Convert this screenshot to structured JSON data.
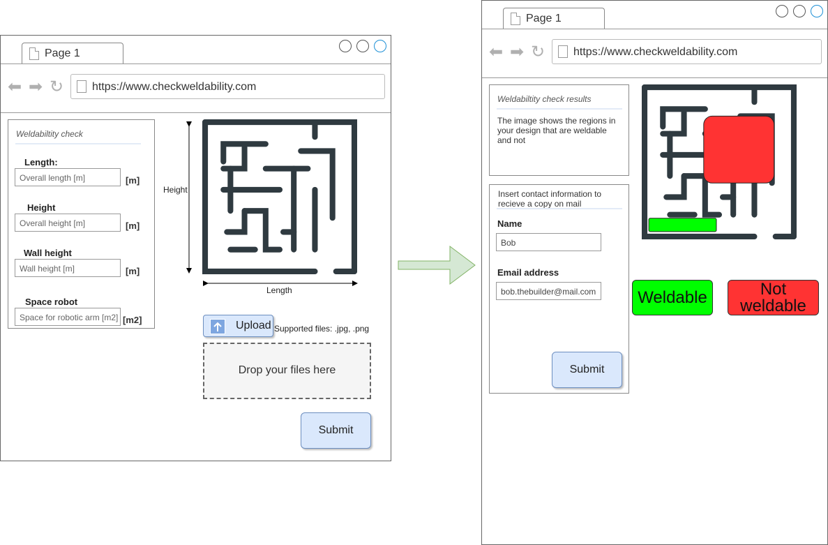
{
  "browser": {
    "tab_label": "Page 1",
    "url": "https://www.checkweldability.com"
  },
  "screen1": {
    "panel_title": "Weldabiltity check",
    "fields": [
      {
        "label": "Length:",
        "placeholder": "Overall length [m]",
        "unit": "[m]"
      },
      {
        "label": "Height",
        "placeholder": "Overall height [m]",
        "unit": "[m]"
      },
      {
        "label": "Wall height",
        "placeholder": "Wall height [m]",
        "unit": "[m]"
      },
      {
        "label": "Space robot",
        "placeholder": "Space for robotic arm [m2]",
        "unit": "[m2]"
      }
    ],
    "height_label": "Height",
    "length_label": "Length",
    "upload_label": "Upload",
    "supported_files": "Supported files: .jpg, .png",
    "dropzone_text": "Drop your files here",
    "submit_label": "Submit"
  },
  "screen2": {
    "results_title": "Weldabiltity check results",
    "results_text": "The image shows the regions in your design that are weldable and not",
    "contact_title": "Insert contact information to recieve a copy on mail",
    "name_label": "Name",
    "name_value": "Bob",
    "email_label": "Email address",
    "email_value": "bob.thebuilder@mail.com",
    "submit_label": "Submit",
    "legend_weldable": "Weldable",
    "legend_not_weldable": "Not weldable"
  },
  "colors": {
    "weldable": "#00ff00",
    "not_weldable": "#ff3333",
    "maze": "#2f3a40",
    "arrow": "#d5e8d4"
  }
}
